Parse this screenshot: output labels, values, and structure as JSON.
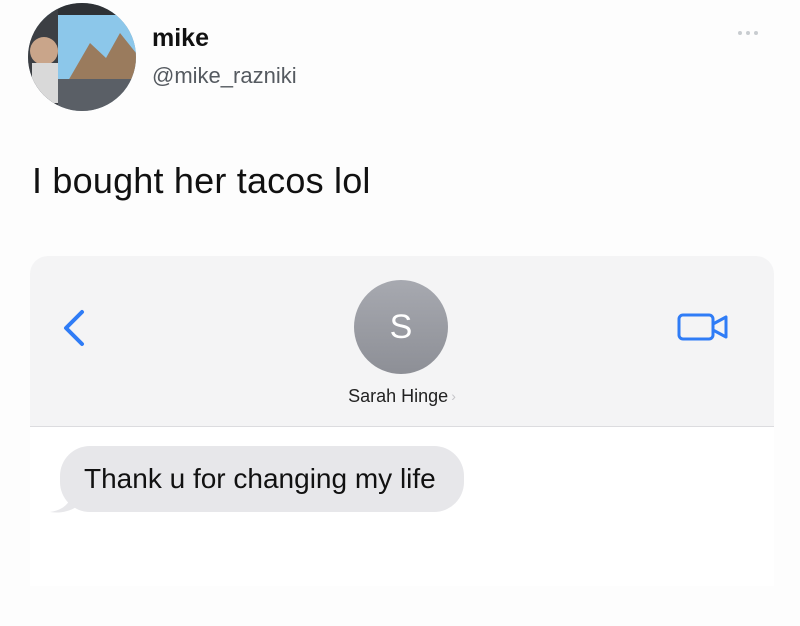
{
  "tweet": {
    "display_name": "mike",
    "handle": "@mike_razniki",
    "text": "I bought her tacos lol",
    "more_icon": "more-horizontal-icon",
    "avatar_icon": "profile-photo"
  },
  "imessage": {
    "contact_initial": "S",
    "contact_name": "Sarah Hinge",
    "contact_chevron": "›",
    "back_icon": "chevron-left-icon",
    "video_icon": "facetime-video-icon",
    "messages": [
      {
        "text": "Thank u for changing my life",
        "direction": "incoming"
      }
    ]
  },
  "colors": {
    "accent_blue": "#2f7cf6",
    "header_bg": "#f4f4f5",
    "bubble_bg": "#e7e7ea",
    "avatar_gray": "#9a9ca3"
  }
}
